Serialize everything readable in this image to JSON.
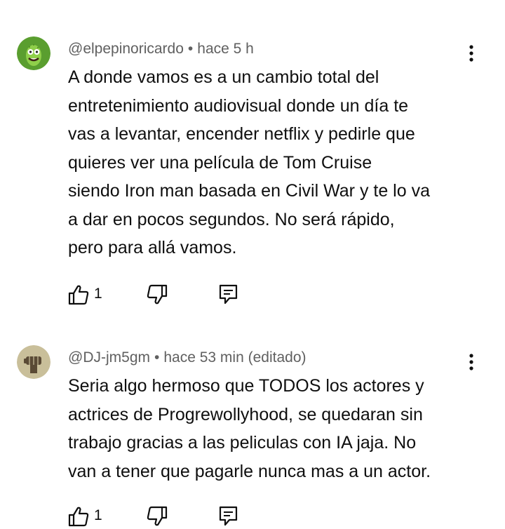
{
  "comments": [
    {
      "author": "@elpepinoricardo",
      "separator": "•",
      "time": "hace 5 h",
      "edited": "",
      "avatar_icon": "pickle-rick-avatar",
      "avatar_color": "#5a9e2f",
      "lines": [
        "A donde vamos es a un cambio total del",
        "entretenimiento audiovisual donde un día te",
        "vas a levantar, encender netflix y pedirle que",
        "quieres ver una película de Tom Cruise",
        "siendo Iron man basada en Civil War y te lo va",
        "a dar en pocos segundos. No será rápido,",
        "pero para allá vamos."
      ],
      "likes": "1"
    },
    {
      "author": "@DJ-jm5gm",
      "separator": "•",
      "time": "hace 53 min",
      "edited": "(editado)",
      "avatar_icon": "fist-avatar",
      "avatar_color": "#c9bf9a",
      "lines": [
        "Seria algo hermoso que TODOS los actores y",
        "actrices de Progrewollyhood, se quedaran sin",
        "trabajo gracias a las peliculas con IA jaja. No",
        "van a tener que pagarle nunca mas a un actor."
      ],
      "likes": "1"
    }
  ],
  "icons": {
    "like": "thumb-up-icon",
    "dislike": "thumb-down-icon",
    "reply": "reply-comment-icon",
    "more": "more-vertical-icon"
  }
}
